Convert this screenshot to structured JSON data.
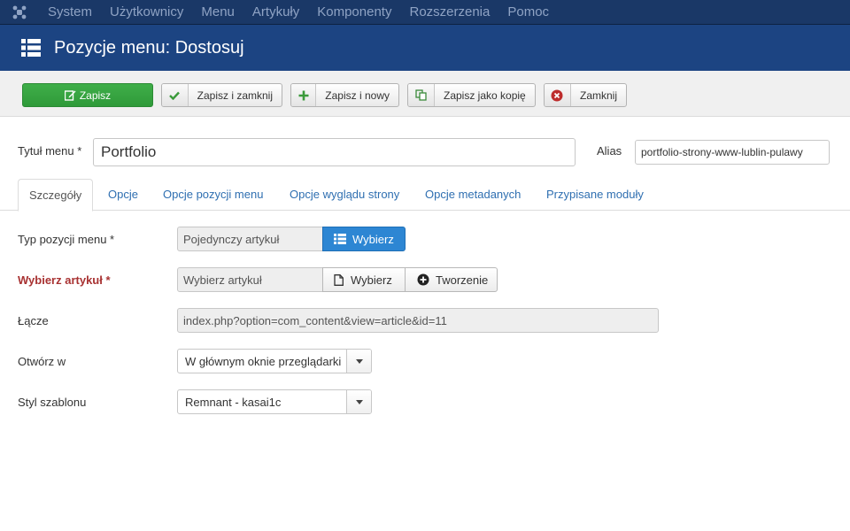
{
  "navbar": {
    "logo_icon": "joomla-logo-icon",
    "items": [
      "System",
      "Użytkownicy",
      "Menu",
      "Artykuły",
      "Komponenty",
      "Rozszerzenia",
      "Pomoc"
    ]
  },
  "header": {
    "icon": "list-icon",
    "title": "Pozycje menu: Dostosuj"
  },
  "toolbar": {
    "save": "Zapisz",
    "save_close": "Zapisz i zamknij",
    "save_new": "Zapisz i nowy",
    "save_copy": "Zapisz jako kopię",
    "close": "Zamknij"
  },
  "form": {
    "title_label": "Tytuł menu *",
    "title_value": "Portfolio",
    "alias_label": "Alias",
    "alias_value": "portfolio-strony-www-lublin-pulawy"
  },
  "tabs": [
    "Szczegóły",
    "Opcje",
    "Opcje pozycji menu",
    "Opcje wyglądu strony",
    "Opcje metadanych",
    "Przypisane moduły"
  ],
  "details": {
    "type_label": "Typ pozycji menu *",
    "type_value": "Pojedynczy artykuł",
    "type_button": "Wybierz",
    "article_label": "Wybierz artykuł *",
    "article_value": "Wybierz artykuł",
    "article_select_button": "Wybierz",
    "article_create_button": "Tworzenie",
    "link_label": "Łącze",
    "link_value": "index.php?option=com_content&view=article&id=11",
    "open_label": "Otwórz w",
    "open_value": "W głównym oknie przeglądarki",
    "style_label": "Styl szablonu",
    "style_value": "Remnant - kasai1c"
  },
  "colors": {
    "navbar": "#1a3867",
    "header": "#1c4482",
    "save_green": "#3fae49",
    "primary_blue": "#2d86d3",
    "required_red": "#a83232",
    "tab_link": "#2f6fb1"
  }
}
